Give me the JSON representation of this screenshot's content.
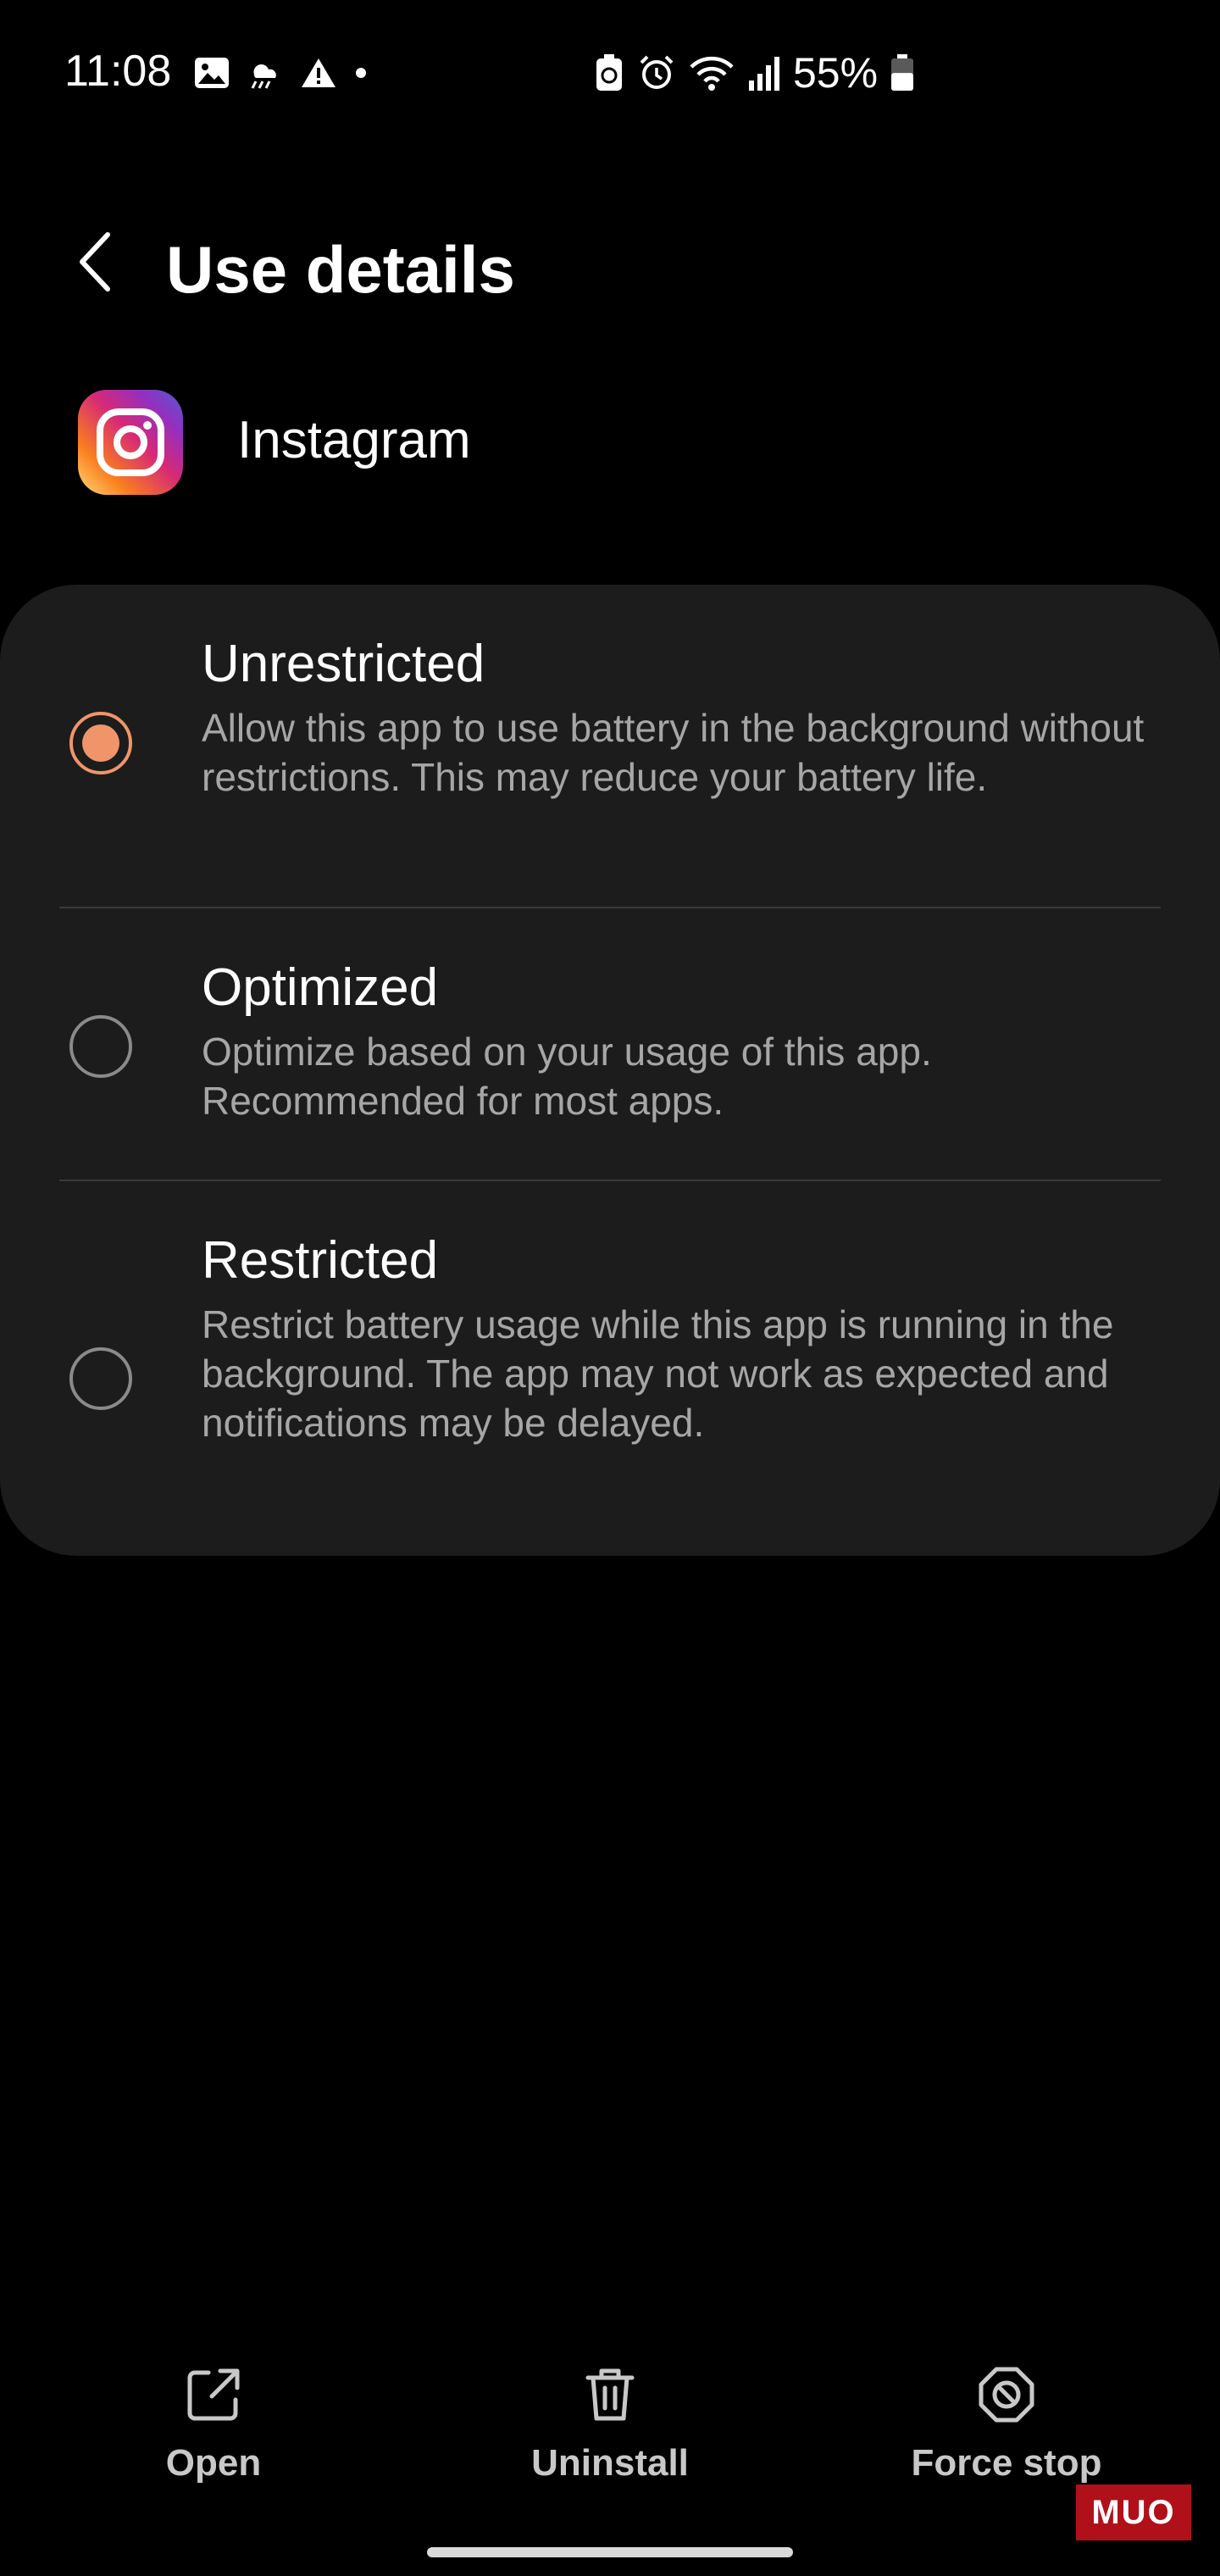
{
  "status_bar": {
    "time": "11:08",
    "battery_percent": "55%",
    "battery_level": 0.55,
    "left_icons": [
      "gallery-icon",
      "weather-icon",
      "warning-icon",
      "dot-icon"
    ],
    "right_icons": [
      "battery-saver-icon",
      "alarm-icon",
      "wifi-icon",
      "signal-icon",
      "battery-icon"
    ]
  },
  "header": {
    "title": "Use details",
    "back_icon": "chevron-left-icon"
  },
  "app": {
    "name": "Instagram",
    "icon": "instagram-icon"
  },
  "options": [
    {
      "title": "Unrestricted",
      "description": "Allow this app to use battery in the background without restrictions. This may reduce your battery life.",
      "selected": true
    },
    {
      "title": "Optimized",
      "description": "Optimize based on your usage of this app. Recommended for most apps.",
      "selected": false
    },
    {
      "title": "Restricted",
      "description": "Restrict battery usage while this app is running in the background. The app may not work as expected and notifications may be delayed.",
      "selected": false
    }
  ],
  "actions": {
    "open": {
      "label": "Open",
      "icon": "open-external-icon"
    },
    "uninstall": {
      "label": "Uninstall",
      "icon": "trash-icon"
    },
    "force_stop": {
      "label": "Force stop",
      "icon": "stop-icon"
    }
  },
  "watermark": {
    "text": "MUO"
  },
  "colors": {
    "accent": "#f0956a",
    "card_background": "#1c1c1c",
    "background": "#000000"
  }
}
